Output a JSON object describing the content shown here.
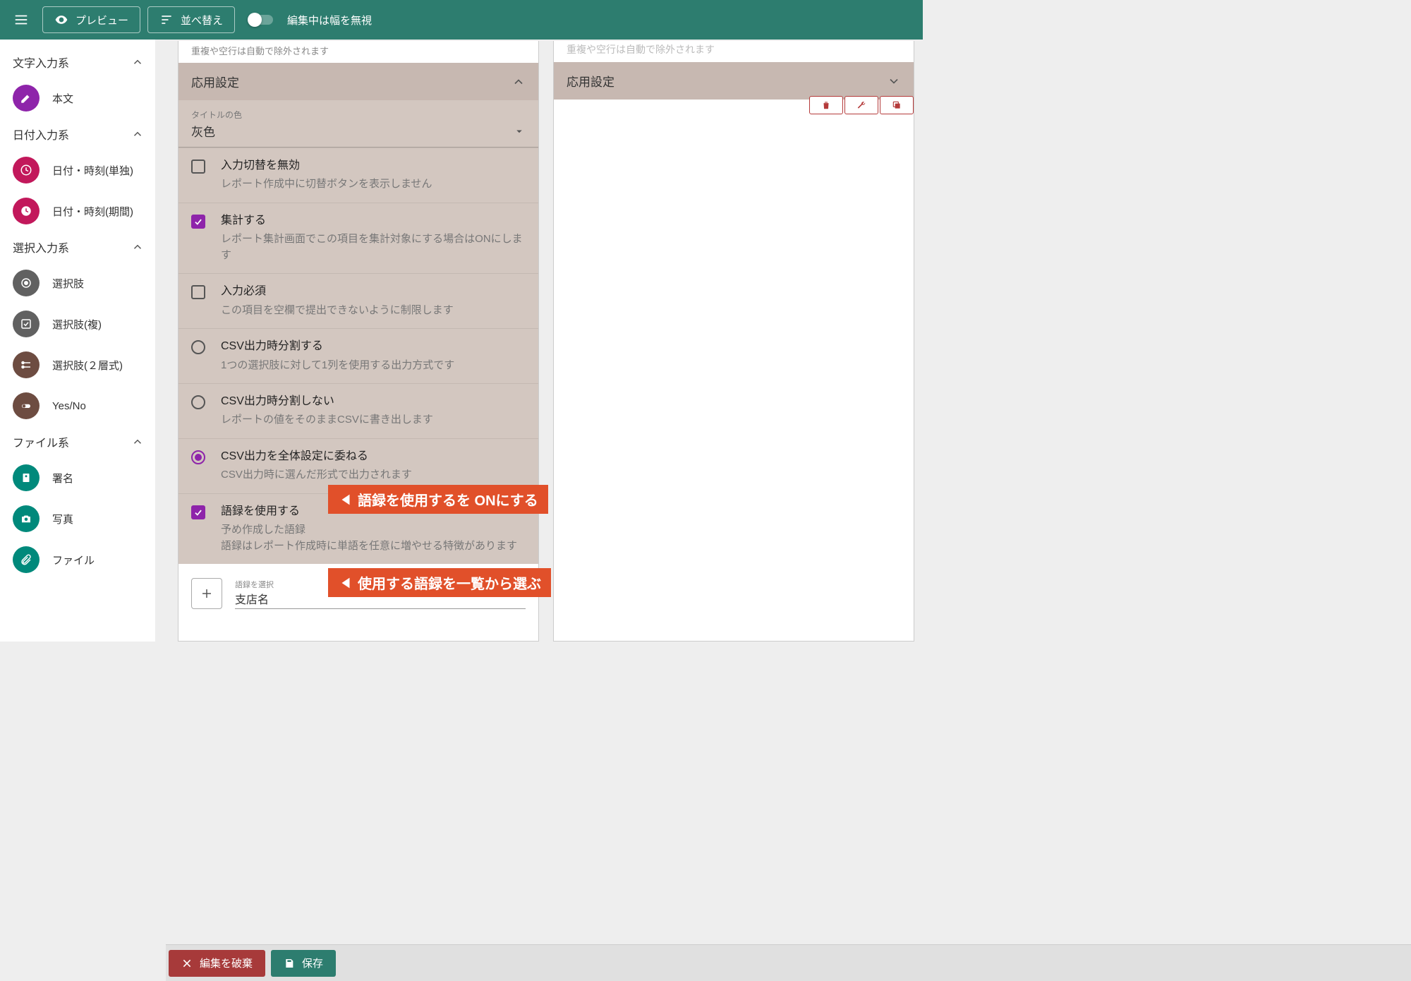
{
  "header": {
    "preview_label": "プレビュー",
    "sort_label": "並べ替え",
    "toggle_label": "編集中は幅を無視"
  },
  "sidebar": {
    "sections": [
      {
        "title": "文字入力系",
        "items": [
          {
            "label": "本文",
            "icon": "pencil",
            "color": "purple"
          }
        ]
      },
      {
        "title": "日付入力系",
        "items": [
          {
            "label": "日付・時刻(単独)",
            "icon": "clock-outline",
            "color": "crimson"
          },
          {
            "label": "日付・時刻(期間)",
            "icon": "clock-solid",
            "color": "crimson"
          }
        ]
      },
      {
        "title": "選択入力系",
        "items": [
          {
            "label": "選択肢",
            "icon": "radio",
            "color": "gray"
          },
          {
            "label": "選択肢(複)",
            "icon": "check",
            "color": "gray"
          },
          {
            "label": "選択肢(２層式)",
            "icon": "tree",
            "color": "brown"
          },
          {
            "label": "Yes/No",
            "icon": "switch",
            "color": "brown"
          }
        ]
      },
      {
        "title": "ファイル系",
        "items": [
          {
            "label": "署名",
            "icon": "stamp",
            "color": "tealc"
          },
          {
            "label": "写真",
            "icon": "camera",
            "color": "tealc"
          },
          {
            "label": "ファイル",
            "icon": "clip",
            "color": "tealc"
          }
        ]
      }
    ]
  },
  "panel": {
    "hint": "重複や空行は自動で除外されます",
    "title": "応用設定",
    "title_color_label": "タイトルの色",
    "title_color_value": "灰色",
    "options": [
      {
        "kind": "checkbox",
        "checked": false,
        "title": "入力切替を無効",
        "desc": "レポート作成中に切替ボタンを表示しません"
      },
      {
        "kind": "checkbox",
        "checked": true,
        "title": "集計する",
        "desc": "レポート集計画面でこの項目を集計対象にする場合はONにします"
      },
      {
        "kind": "checkbox",
        "checked": false,
        "title": "入力必須",
        "desc": "この項目を空欄で提出できないように制限します"
      },
      {
        "kind": "radio",
        "checked": false,
        "title": "CSV出力時分割する",
        "desc": "1つの選択肢に対して1列を使用する出力方式です"
      },
      {
        "kind": "radio",
        "checked": false,
        "title": "CSV出力時分割しない",
        "desc": "レポートの値をそのままCSVに書き出します"
      },
      {
        "kind": "radio",
        "checked": true,
        "title": "CSV出力を全体設定に委ねる",
        "desc": "CSV出力時に選んだ形式で出力されます"
      },
      {
        "kind": "checkbox",
        "checked": true,
        "title": "語録を使用する",
        "desc": "予め作成した語録\n語録はレポート作成時に単語を任意に増やせる特徴があります"
      }
    ],
    "select_glossary_label": "語録を選択",
    "select_glossary_value": "支店名"
  },
  "right_panel": {
    "hint_cut": "重複や空行は自動で除外されます",
    "title": "応用設定"
  },
  "callouts": {
    "c1": "語録を使用するを ONにする",
    "c2": "使用する語録を一覧から選ぶ"
  },
  "footer": {
    "discard": "編集を破棄",
    "save": "保存"
  }
}
